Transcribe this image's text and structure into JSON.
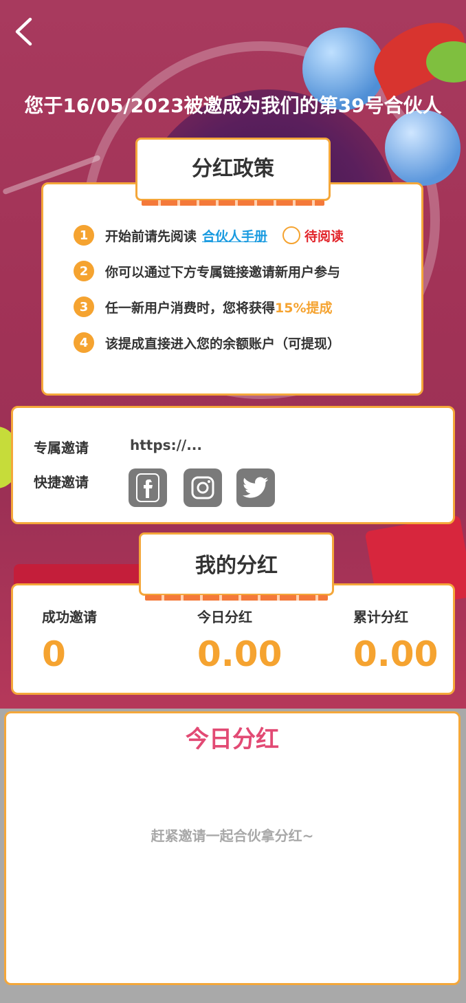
{
  "header": {
    "invite_title": "您于16/05/2023被邀成为我们的第39号合伙人"
  },
  "policy": {
    "tab_title": "分红政策",
    "items": [
      {
        "num": "1",
        "text": "开始前请先阅读",
        "link": "合伙人手册",
        "status": "待阅读"
      },
      {
        "num": "2",
        "text": "你可以通过下方专属链接邀请新用户参与"
      },
      {
        "num": "3",
        "text": "任一新用户消费时，您将获得",
        "highlight": "15%提成"
      },
      {
        "num": "4",
        "text": "该提成直接进入您的余额账户（可提现）"
      }
    ]
  },
  "invite": {
    "exclusive_label": "专属邀请",
    "url": "https://...",
    "quick_label": "快捷邀请",
    "social_icons": [
      "facebook-icon",
      "instagram-icon",
      "twitter-icon"
    ]
  },
  "dividend": {
    "tab_title": "我的分红",
    "stats": [
      {
        "label": "成功邀请",
        "value": "0"
      },
      {
        "label": "今日分红",
        "value": "0.00"
      },
      {
        "label": "累计分红",
        "value": "0.00"
      }
    ]
  },
  "today": {
    "title": "今日分红",
    "empty_text": "赶紧邀请一起合伙拿分红~"
  },
  "colors": {
    "accent": "#f5a330",
    "border": "#f4a73a",
    "link": "#1a9be0",
    "pending": "#e2252b",
    "today_title": "#e24a74"
  }
}
